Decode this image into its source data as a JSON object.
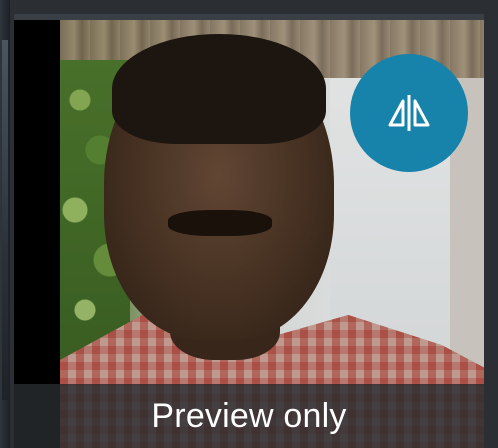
{
  "preview": {
    "caption": "Preview only",
    "flip_button_icon": "mirror-flip-icon",
    "accent_color": "#1782aa"
  }
}
